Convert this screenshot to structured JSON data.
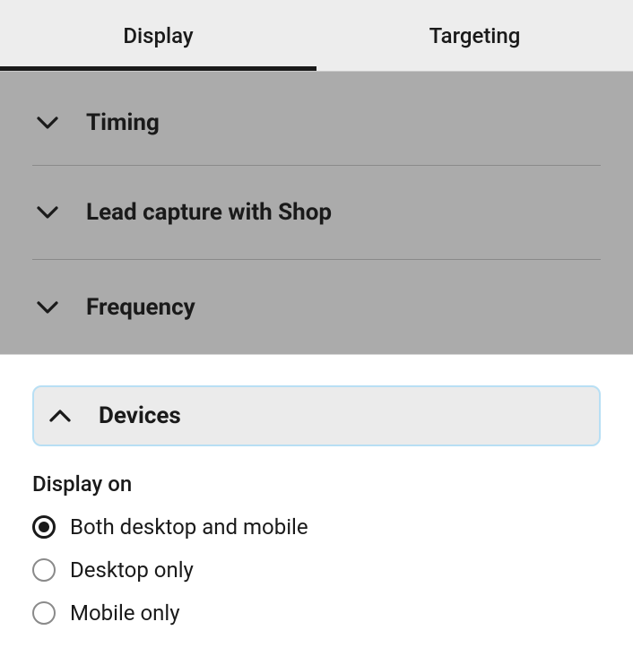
{
  "tabs": {
    "display": "Display",
    "targeting": "Targeting"
  },
  "sections": {
    "timing": {
      "label": "Timing"
    },
    "leadCapture": {
      "label": "Lead capture with Shop"
    },
    "frequency": {
      "label": "Frequency"
    },
    "devices": {
      "label": "Devices"
    }
  },
  "devices": {
    "groupLabel": "Display on",
    "options": {
      "both": "Both desktop and mobile",
      "desktop": "Desktop only",
      "mobile": "Mobile only"
    },
    "selected": "both"
  }
}
